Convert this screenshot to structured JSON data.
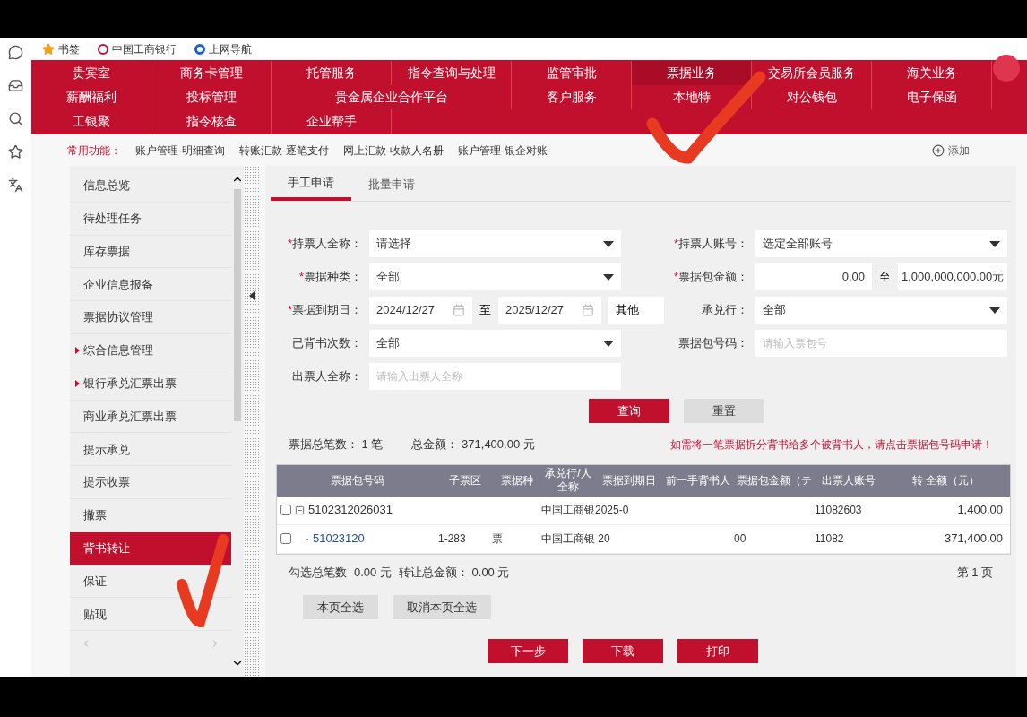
{
  "bookmarks": [
    {
      "kind": "star",
      "label": "书签"
    },
    {
      "kind": "bank",
      "label": "中国工商银行"
    },
    {
      "kind": "nav",
      "label": "上网导航"
    }
  ],
  "nav_rows": [
    [
      {
        "label": "贵宾室",
        "selected": false,
        "wide": false
      },
      {
        "label": "商务卡管理",
        "selected": false,
        "wide": false
      },
      {
        "label": "托管服务",
        "selected": false,
        "wide": false
      },
      {
        "label": "指令查询与处理",
        "selected": false,
        "wide": false
      },
      {
        "label": "监管审批",
        "selected": false,
        "wide": false
      },
      {
        "label": "票据业务",
        "selected": true,
        "wide": false
      },
      {
        "label": "交易所会员服务",
        "selected": false,
        "wide": false
      },
      {
        "label": "海关业务",
        "selected": false,
        "wide": false
      }
    ],
    [
      {
        "label": "薪酬福利",
        "selected": false,
        "wide": false
      },
      {
        "label": "投标管理",
        "selected": false,
        "wide": false
      },
      {
        "label": "贵金属企业合作平台",
        "selected": false,
        "wide": true
      },
      {
        "label": "客户服务",
        "selected": false,
        "wide": false
      },
      {
        "label": "本地特",
        "selected": false,
        "wide": false
      },
      {
        "label": "对公钱包",
        "selected": false,
        "wide": false
      },
      {
        "label": "电子保函",
        "selected": false,
        "wide": false
      }
    ],
    [
      {
        "label": "工银聚",
        "selected": false,
        "wide": false
      },
      {
        "label": "指令核查",
        "selected": false,
        "wide": false
      },
      {
        "label": "企业帮手",
        "selected": false,
        "wide": false
      }
    ]
  ],
  "quick": {
    "label": "常用功能：",
    "items": [
      "账户管理-明细查询",
      "转账汇款-逐笔支付",
      "网上汇款-收款人名册",
      "账户管理-银企对账"
    ],
    "add": "添加"
  },
  "sidebar": [
    {
      "label": "信息总览",
      "selected": false,
      "expandable": false
    },
    {
      "label": "待处理任务",
      "selected": false,
      "expandable": false
    },
    {
      "label": "库存票据",
      "selected": false,
      "expandable": false
    },
    {
      "label": "企业信息报备",
      "selected": false,
      "expandable": false
    },
    {
      "label": "票据协议管理",
      "selected": false,
      "expandable": false
    },
    {
      "label": "综合信息管理",
      "selected": false,
      "expandable": true
    },
    {
      "label": "银行承兑汇票出票",
      "selected": false,
      "expandable": true
    },
    {
      "label": "商业承兑汇票出票",
      "selected": false,
      "expandable": false
    },
    {
      "label": "提示承兑",
      "selected": false,
      "expandable": false
    },
    {
      "label": "提示收票",
      "selected": false,
      "expandable": false
    },
    {
      "label": "撤票",
      "selected": false,
      "expandable": false
    },
    {
      "label": "背书转让",
      "selected": true,
      "expandable": false
    },
    {
      "label": "保证",
      "selected": false,
      "expandable": false
    },
    {
      "label": "贴现",
      "selected": false,
      "expandable": false
    }
  ],
  "tabs": [
    {
      "label": "手工申请",
      "selected": true
    },
    {
      "label": "批量申请",
      "selected": false
    }
  ],
  "form_rows": [
    [
      {
        "kind": "select",
        "required": true,
        "required_mark": "*",
        "label": "持票人全称：",
        "value": "请选择"
      },
      {
        "kind": "select",
        "required": true,
        "required_mark": "*",
        "label": "持票人账号：",
        "value": "选定全部账号"
      }
    ],
    [
      {
        "kind": "select",
        "required": true,
        "required_mark": "*",
        "label": "票据种类：",
        "value": "全部"
      },
      {
        "kind": "range",
        "required": true,
        "required_mark": "*",
        "label": "票据包金额：",
        "from": "0.00",
        "sep": "至",
        "to": "1,000,000,000.00元"
      }
    ],
    [
      {
        "kind": "dates",
        "required": true,
        "required_mark": "*",
        "label": "票据到期日：",
        "from": "2024/12/27",
        "sep": "至",
        "to": "2025/12/27",
        "extra": "其他"
      },
      {
        "kind": "select",
        "required": false,
        "label": "承兑行：",
        "value": "全部"
      }
    ],
    [
      {
        "kind": "select",
        "required": false,
        "label": "已背书次数：",
        "value": "全部"
      },
      {
        "kind": "text",
        "required": false,
        "label": "票据包号码：",
        "placeholder": "请输入票包号"
      }
    ],
    [
      {
        "kind": "text",
        "required": false,
        "label": "出票人全称：",
        "placeholder": "请输入出票人全称"
      }
    ]
  ],
  "actions": [
    {
      "label": "查询",
      "primary": true
    },
    {
      "label": "重置",
      "primary": false
    }
  ],
  "summary": {
    "count": "票据总笔数： 1 笔",
    "total": "总金额： 371,400.00 元",
    "notice": "如需将一笔票据拆分背书给多个被背书人，请点击票据包号码申请！"
  },
  "table": {
    "columns": [
      "票据包号码",
      "子票区",
      "票据种",
      "承兑行/人全称",
      "票据到期日",
      "前一手背书人",
      "票据包金额（テ",
      "出票人账号",
      "转 全额（元）"
    ],
    "rows": [
      {
        "checked": false,
        "kind": "parent",
        "cells": [
          "5102312026031",
          "",
          "",
          "中国工商银",
          "2025-0",
          "",
          "",
          "11082603",
          "1,400.00"
        ]
      },
      {
        "checked": false,
        "kind": "child",
        "cells": [
          "· 51023120",
          "1-283",
          "票",
          "中国工商银 20",
          "",
          "",
          "00",
          "11082",
          "371,400.00"
        ]
      }
    ]
  },
  "footer": {
    "selected": "勾选总笔数",
    "selected_amount": "0.00 元",
    "transfer": "转让总金额： 0.00 元",
    "page": "第 1 页"
  },
  "select_buttons": [
    "本页全选",
    "取消本页全选"
  ],
  "bottom_buttons": [
    "下一步",
    "下载",
    "打印"
  ]
}
